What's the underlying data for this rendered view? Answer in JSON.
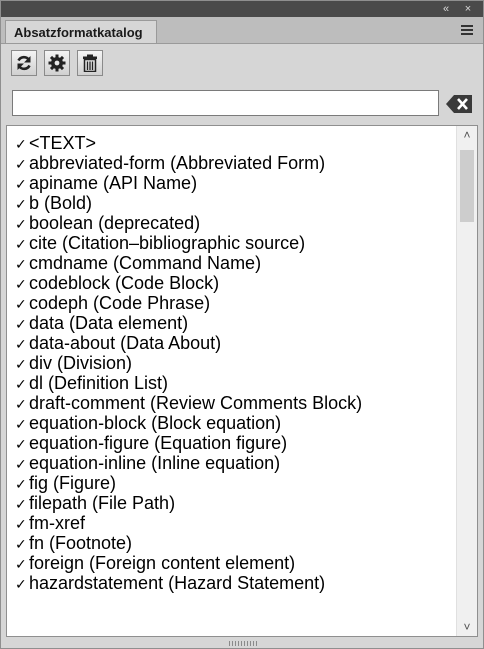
{
  "panel": {
    "tab_label": "Absatzformatkatalog",
    "collapse_glyph": "«",
    "close_glyph": "×"
  },
  "search": {
    "value": "",
    "placeholder": ""
  },
  "icons": {
    "refresh": "refresh-icon",
    "settings": "gear-icon",
    "delete": "trash-icon",
    "clear": "clear-search-icon",
    "menu": "panel-menu-icon"
  },
  "list": {
    "check_glyph": "✓",
    "items": [
      "<TEXT>",
      "abbreviated-form  (Abbreviated Form)",
      "apiname  (API Name)",
      "b  (Bold)",
      "boolean  (deprecated)",
      "cite  (Citation–bibliographic source)",
      "cmdname  (Command Name)",
      "codeblock  (Code Block)",
      "codeph  (Code Phrase)",
      "data  (Data element)",
      "data-about  (Data About)",
      "div  (Division)",
      "dl  (Definition List)",
      "draft-comment  (Review Comments Block)",
      "equation-block  (Block equation)",
      "equation-figure  (Equation figure)",
      "equation-inline  (Inline equation)",
      "fig  (Figure)",
      "filepath  (File Path)",
      "fm-xref",
      "fn  (Footnote)",
      "foreign  (Foreign content element)",
      "hazardstatement  (Hazard Statement)"
    ]
  },
  "scrollbar": {
    "up_glyph": "˄",
    "down_glyph": "˅"
  },
  "colors": {
    "panel_bg": "#d6d6d6",
    "title_strip": "#4a4a4a",
    "list_bg": "#ffffff",
    "clear_icon": "#3a3a3a"
  }
}
